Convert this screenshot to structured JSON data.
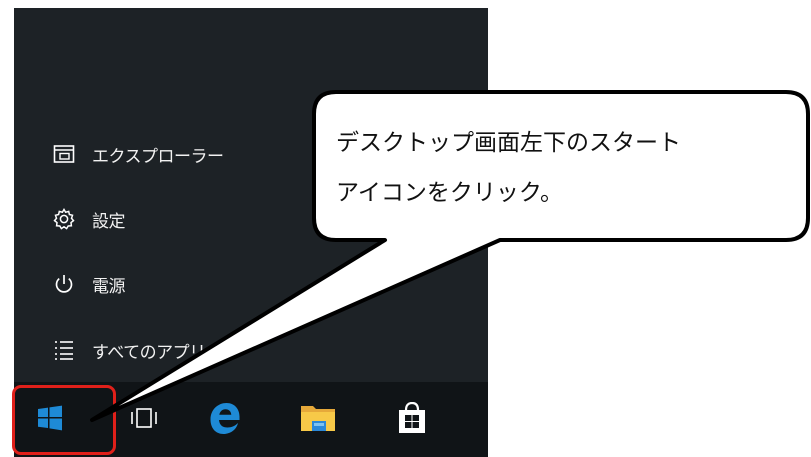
{
  "start_menu": {
    "items": [
      {
        "label": "エクスプローラー",
        "icon": "file-explorer-icon"
      },
      {
        "label": "設定",
        "icon": "gear-icon"
      },
      {
        "label": "電源",
        "icon": "power-icon"
      },
      {
        "label": "すべてのアプリ",
        "icon": "list-icon"
      }
    ]
  },
  "taskbar": {
    "buttons": [
      {
        "name": "start-button",
        "icon": "windows-logo-icon"
      },
      {
        "name": "task-view-button",
        "icon": "task-view-icon"
      },
      {
        "name": "edge-button",
        "icon": "edge-icon"
      },
      {
        "name": "file-explorer-button",
        "icon": "folder-icon"
      },
      {
        "name": "store-button",
        "icon": "store-bag-icon"
      }
    ]
  },
  "callout": {
    "line1": "デスクトップ画面左下のスタート",
    "line2": "アイコンをクリック。"
  },
  "colors": {
    "menu_bg": "#1d2226",
    "taskbar_bg": "#101417",
    "accent_blue": "#1e8ad6",
    "highlight_red": "#e0201a"
  }
}
